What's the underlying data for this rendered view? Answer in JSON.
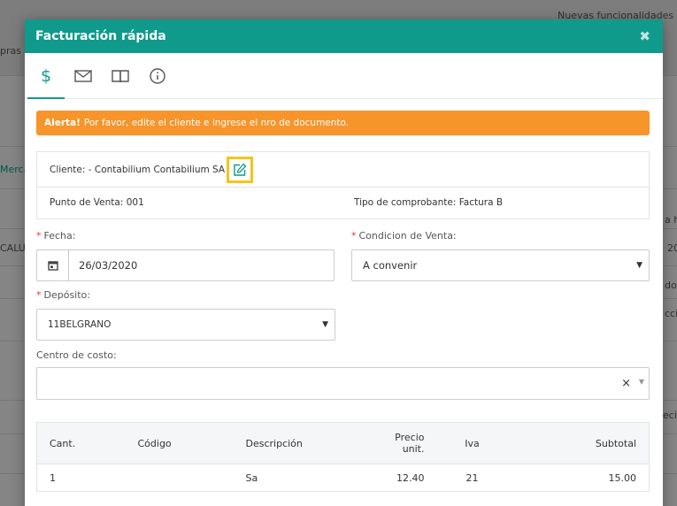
{
  "background": {
    "top_link": "Nuevas funcionalidades",
    "left_frag_1": "pras",
    "left_frag_2": "Merca",
    "left_frag_3": "CALU",
    "right_frag_1": "a h",
    "right_frag_2": "20",
    "right_frag_3": "do",
    "right_frag_4": "cci",
    "right_frag_5": "ecia"
  },
  "modal": {
    "title": "Facturación rápida",
    "close_label": "✖",
    "tabs": [
      {
        "icon": "dollar-icon",
        "label": "$",
        "active": true
      },
      {
        "icon": "envelope-icon",
        "active": false
      },
      {
        "icon": "book-icon",
        "active": false
      },
      {
        "icon": "info-icon",
        "active": false
      }
    ],
    "alert": {
      "strong": "Alerta!",
      "text": "Por favor, edite el cliente e ingrese el nro de documento.",
      "color": "#f7942a"
    },
    "client_label": "Cliente: - Contabilium Contabilium SA",
    "punto_venta": "Punto de Venta: 001",
    "tipo_comprobante": "Tipo de comprobante: Factura B",
    "form": {
      "fecha_label": "Fecha:",
      "fecha_value": "26/03/2020",
      "condicion_label": "Condicion de Venta:",
      "condicion_value": "A convenir",
      "deposito_label": "Depósito:",
      "deposito_value": "11BELGRANO",
      "centro_label": "Centro de costo:",
      "centro_value": "",
      "required_mark": "*"
    },
    "table": {
      "headers": {
        "cant": "Cant.",
        "codigo": "Código",
        "descripcion": "Descripción",
        "precio": "Precio unit.",
        "iva": "Iva",
        "subtotal": "Subtotal"
      },
      "rows": [
        {
          "cant": "1",
          "codigo": "",
          "descripcion": "Sa",
          "precio": "12.40",
          "iva": "21",
          "subtotal": "15.00"
        }
      ]
    },
    "accent_color": "#0f9a8c",
    "highlight_color": "#f5c518"
  }
}
